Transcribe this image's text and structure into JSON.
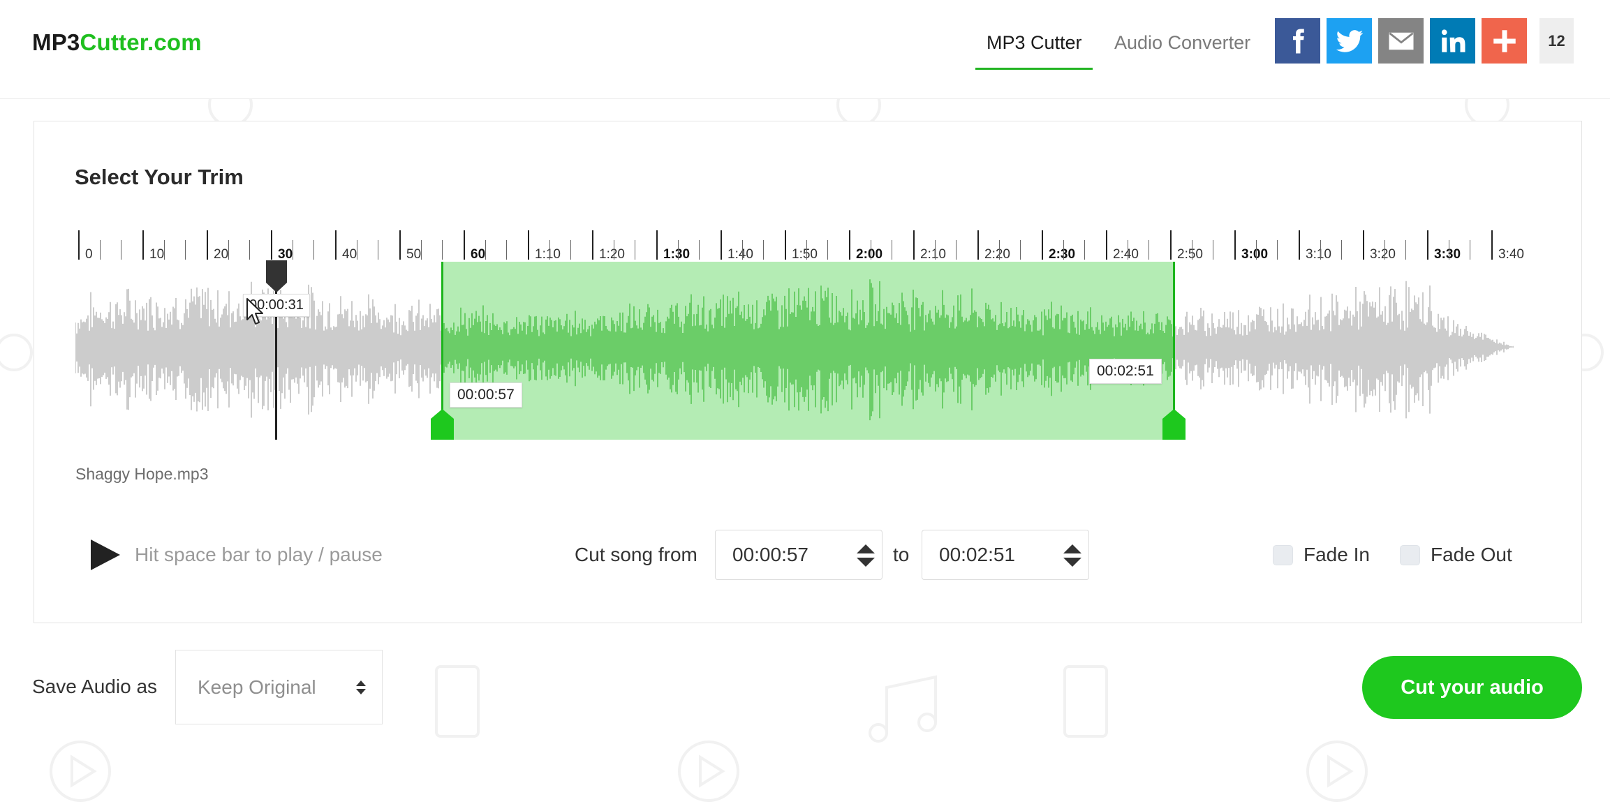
{
  "header": {
    "logo_part1": "MP3",
    "logo_part2": "Cutter.com",
    "tabs": [
      {
        "label": "MP3 Cutter",
        "active": true
      },
      {
        "label": "Audio Converter",
        "active": false
      }
    ],
    "share_buttons": [
      {
        "name": "facebook-icon",
        "color": "#3b5998"
      },
      {
        "name": "twitter-icon",
        "color": "#1da1f2"
      },
      {
        "name": "email-icon",
        "color": "#848484"
      },
      {
        "name": "linkedin-icon",
        "color": "#007bb5"
      },
      {
        "name": "plus-icon",
        "color": "#f0654c"
      }
    ],
    "share_count": "12"
  },
  "editor": {
    "title": "Select Your Trim",
    "timeline_labels": [
      "0",
      "10",
      "20",
      "30",
      "40",
      "50",
      "60",
      "1:10",
      "1:20",
      "1:30",
      "1:40",
      "1:50",
      "2:00",
      "2:10",
      "2:20",
      "2:30",
      "2:40",
      "2:50",
      "3:00",
      "3:10",
      "3:20",
      "3:30",
      "3:40"
    ],
    "bold_labels": [
      "30",
      "60",
      "1:30",
      "2:00",
      "2:30",
      "3:00",
      "3:30"
    ],
    "total_seconds": 226,
    "playhead_time": "00:00:31",
    "selection_start": "00:00:57",
    "selection_end": "00:02:51",
    "filename": "Shaggy Hope.mp3",
    "play_hint": "Hit space bar to play / pause",
    "cut_from_label": "Cut song from",
    "from_value": "00:00:57",
    "to_label": "to",
    "to_value": "00:02:51",
    "fade_in_label": "Fade In",
    "fade_out_label": "Fade Out",
    "fade_in_checked": false,
    "fade_out_checked": false
  },
  "footer": {
    "save_label": "Save Audio as",
    "format_value": "Keep Original",
    "cut_button": "Cut your audio"
  },
  "colors": {
    "accent": "#1ec81e",
    "selection": "#b3ecaf",
    "wave_gray": "#cccccc",
    "wave_green": "#8fd08a"
  }
}
